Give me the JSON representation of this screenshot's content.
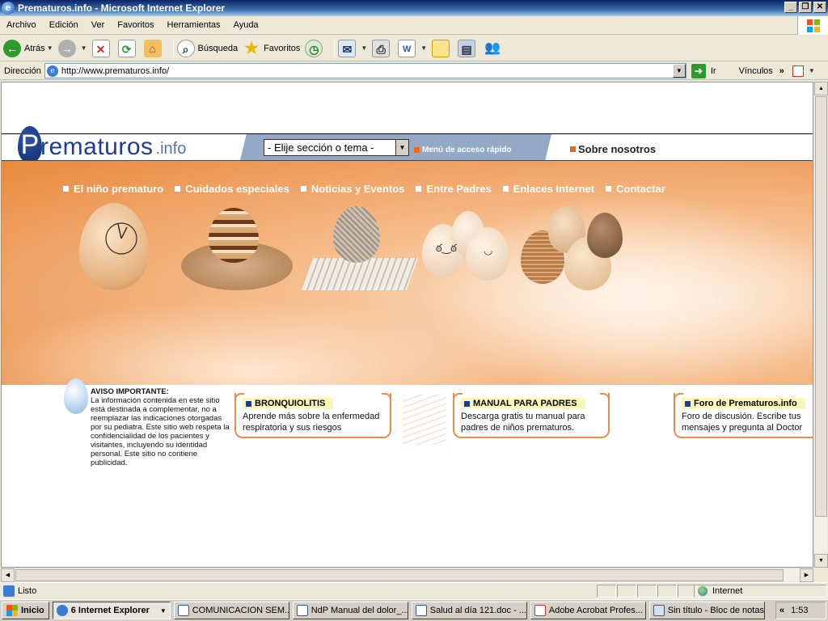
{
  "window": {
    "title": "Prematuros.info - Microsoft Internet Explorer"
  },
  "menu": [
    "Archivo",
    "Edición",
    "Ver",
    "Favoritos",
    "Herramientas",
    "Ayuda"
  ],
  "toolbar": {
    "back": "Atrás",
    "search": "Búsqueda",
    "favorites": "Favoritos"
  },
  "address": {
    "label": "Dirección",
    "url": "http://www.prematuros.info/",
    "go": "Ir",
    "links": "Vínculos"
  },
  "site": {
    "logo_main": "rematuros",
    "logo_letter": "P",
    "logo_sub": ".info",
    "select_value": "- Elije sección o tema -",
    "quick_menu": "Menú de acceso rápido",
    "about": "Sobre nosotros",
    "nav": [
      "El niño prematuro",
      "Cuidados especiales",
      "Noticias y Eventos",
      "Entre Padres",
      "Enlaces Internet",
      "Contactar"
    ],
    "notice_title": "AVISO IMPORTANTE:",
    "notice_text": "La información contenida en este sitio está destinada a complementar, no a reemplazar las indicaciones otorgadas por su pediatra. Este sitio web respeta la confidencialidad de los pacientes y visitantes, incluyendo su identidad personal. Este sitio no contiene publicidad.",
    "cards": [
      {
        "title": "BRONQUIOLITIS",
        "desc1": "Aprende más sobre la enfermedad",
        "desc2": "respiratoria y sus riesgos"
      },
      {
        "title": "MANUAL PARA PADRES",
        "desc1": "Descarga gratis tu manual para",
        "desc2": "padres de niños prematuros."
      },
      {
        "title": "Foro de Prematuros.info",
        "desc1": "Foro de discusión. Escribe tus",
        "desc2": "mensajes y pregunta al Doctor"
      }
    ]
  },
  "status": {
    "text": "Listo",
    "zone": "Internet"
  },
  "taskbar": {
    "start": "Inicio",
    "tasks": [
      "6 Internet Explorer",
      "COMUNICACION SEM...",
      "NdP Manual del dolor_...",
      "Salud al día 121.doc - ...",
      "Adobe Acrobat Profes...",
      "Sin título - Bloc de notas"
    ],
    "clock": "1:53"
  },
  "colors": {
    "accent_orange": "#e86a1a",
    "brand_blue": "#1e3d8f",
    "xp_title": "#0a246a"
  }
}
